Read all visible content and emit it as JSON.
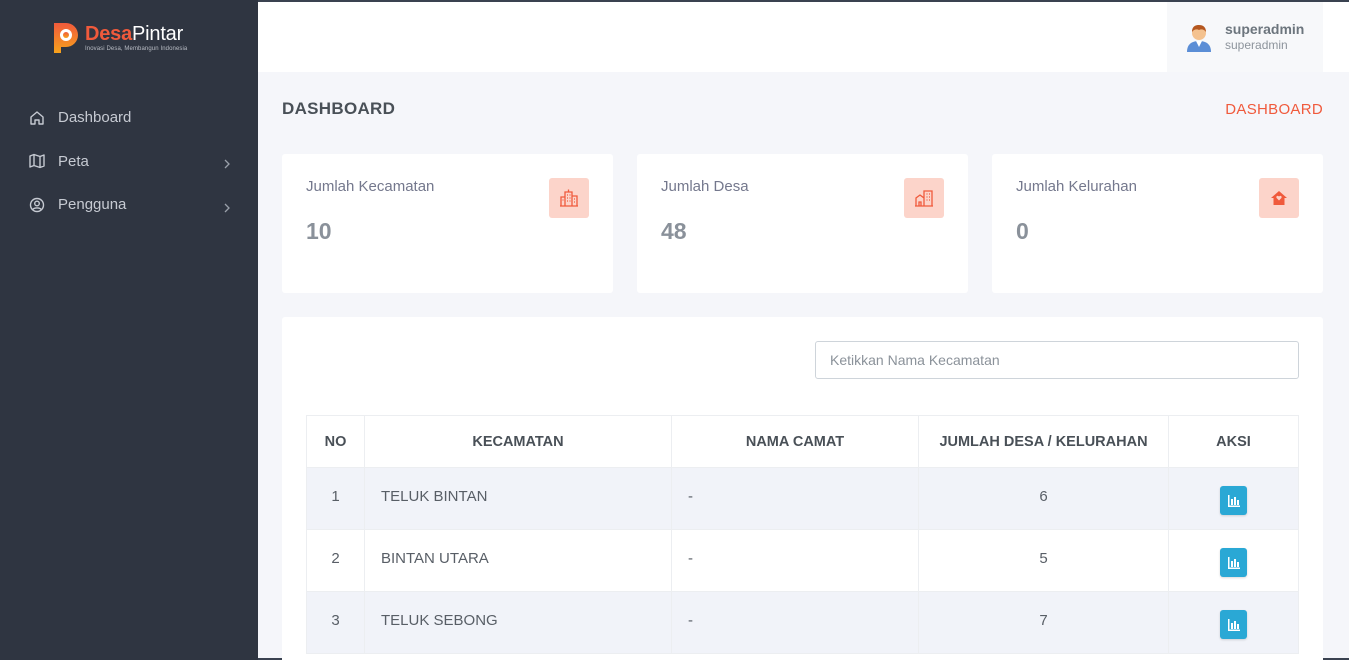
{
  "brand": {
    "name_part1": "Desa",
    "name_part2": "Pintar",
    "tagline": "Inovasi Desa, Membangun Indonesia"
  },
  "sidebar": {
    "items": [
      {
        "label": "Dashboard",
        "icon": "home-icon"
      },
      {
        "label": "Peta",
        "icon": "map-icon",
        "has_submenu": true
      },
      {
        "label": "Pengguna",
        "icon": "user-circle-icon",
        "has_submenu": true
      }
    ]
  },
  "user": {
    "name": "superadmin",
    "role": "superadmin"
  },
  "header": {
    "title": "DASHBOARD",
    "breadcrumb": "DASHBOARD"
  },
  "stats": [
    {
      "label": "Jumlah Kecamatan",
      "value": "10",
      "icon": "city-icon"
    },
    {
      "label": "Jumlah Desa",
      "value": "48",
      "icon": "building-icon"
    },
    {
      "label": "Jumlah Kelurahan",
      "value": "0",
      "icon": "house-icon"
    }
  ],
  "search": {
    "placeholder": "Ketikkan Nama Kecamatan",
    "value": ""
  },
  "table": {
    "columns": [
      "NO",
      "KECAMATAN",
      "NAMA CAMAT",
      "JUMLAH DESA / KELURAHAN",
      "AKSI"
    ],
    "rows": [
      {
        "no": "1",
        "kecamatan": "TELUK BINTAN",
        "camat": "-",
        "jumlah": "6"
      },
      {
        "no": "2",
        "kecamatan": "BINTAN UTARA",
        "camat": "-",
        "jumlah": "5"
      },
      {
        "no": "3",
        "kecamatan": "TELUK SEBONG",
        "camat": "-",
        "jumlah": "7"
      }
    ]
  },
  "colors": {
    "accent": "#f05a3c",
    "sidebar": "#2f3541",
    "action": "#2aa8d5",
    "icon_bg": "#fcd4ca"
  }
}
